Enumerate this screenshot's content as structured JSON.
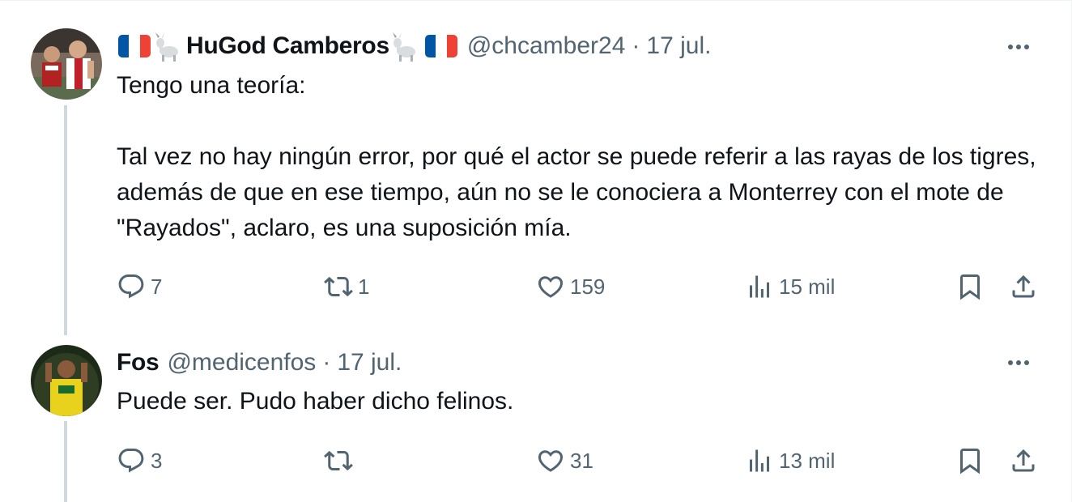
{
  "tweets": [
    {
      "author": {
        "display_name": "HuGod Camberos",
        "handle": "@chcamber24",
        "decor_left": [
          "flag-france-icon",
          "goat-icon"
        ],
        "decor_right": [
          "goat-icon",
          "flag-france-icon"
        ]
      },
      "separator": "·",
      "date": "17 jul.",
      "text": {
        "p1": "Tengo una teoría:",
        "p2": "Tal vez no hay ningún error, por qué el actor se puede referir a las rayas de los tigres, además de que en ese tiempo, aún no se le conociera a Monterrey con el mote de \"Rayados\", aclaro, es una suposición mía."
      },
      "actions": {
        "replies": "7",
        "reposts": "1",
        "likes": "159",
        "views": "15 mil"
      }
    },
    {
      "author": {
        "display_name": "Fos",
        "handle": "@medicenfos"
      },
      "separator": "·",
      "date": "17 jul.",
      "text": {
        "p1": "Puede ser. Pudo haber dicho felinos."
      },
      "actions": {
        "replies": "3",
        "reposts": "",
        "likes": "31",
        "views": "13 mil"
      }
    }
  ],
  "colors": {
    "text": "#0f1419",
    "secondary": "#536471",
    "thread_line": "#cfd9de",
    "flag_blue": "#0055a4",
    "flag_red": "#ef4135"
  }
}
